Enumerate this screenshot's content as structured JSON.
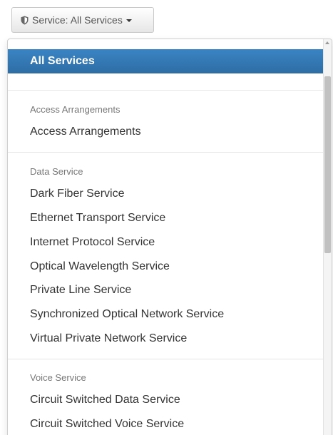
{
  "toggle": {
    "label": "Service: All Services",
    "icon": "shield-icon"
  },
  "menu": {
    "selected": "All Services",
    "groups": [
      {
        "header": "Access Arrangements",
        "items": [
          "Access Arrangements"
        ]
      },
      {
        "header": "Data Service",
        "items": [
          "Dark Fiber Service",
          "Ethernet Transport Service",
          "Internet Protocol Service",
          "Optical Wavelength Service",
          "Private Line Service",
          "Synchronized Optical Network Service",
          "Virtual Private Network Service"
        ]
      },
      {
        "header": "Voice Service",
        "items": [
          "Circuit Switched Data Service",
          "Circuit Switched Voice Service"
        ]
      }
    ]
  },
  "colors": {
    "selected_bg": "#337ab7",
    "text": "#333333",
    "header_text": "#777777"
  }
}
